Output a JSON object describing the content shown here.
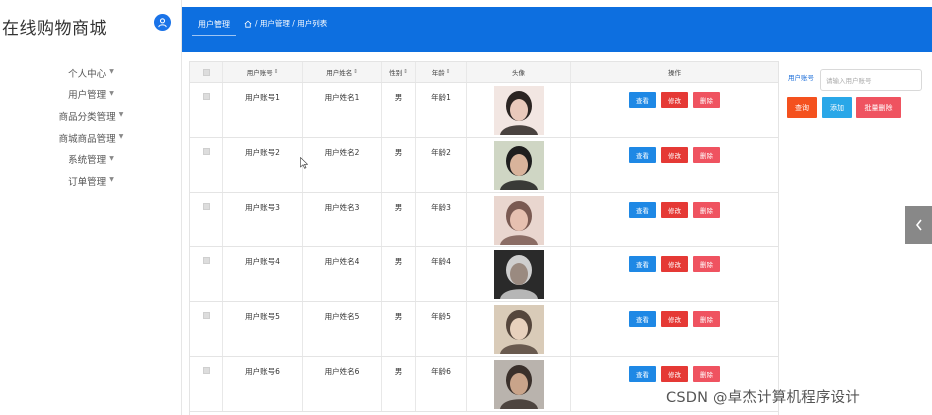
{
  "app": {
    "brand": "在线购物商城"
  },
  "sidebar": {
    "items": [
      {
        "label": "个人中心"
      },
      {
        "label": "用户管理"
      },
      {
        "label": "商品分类管理"
      },
      {
        "label": "商城商品管理"
      },
      {
        "label": "系统管理"
      },
      {
        "label": "订单管理"
      }
    ]
  },
  "header": {
    "tab": "用户管理",
    "breadcrumb": "/ 用户管理 / 用户列表"
  },
  "table": {
    "headers": {
      "account": "用户账号",
      "name": "用户姓名",
      "sex": "性别",
      "age": "年龄",
      "photo": "头像",
      "ops": "操作",
      "sort_mark": "⇕"
    },
    "rows": [
      {
        "account": "用户账号1",
        "name": "用户姓名1",
        "sex": "男",
        "age": "年龄1"
      },
      {
        "account": "用户账号2",
        "name": "用户姓名2",
        "sex": "男",
        "age": "年龄2"
      },
      {
        "account": "用户账号3",
        "name": "用户姓名3",
        "sex": "男",
        "age": "年龄3"
      },
      {
        "account": "用户账号4",
        "name": "用户姓名4",
        "sex": "男",
        "age": "年龄4"
      },
      {
        "account": "用户账号5",
        "name": "用户姓名5",
        "sex": "男",
        "age": "年龄5"
      },
      {
        "account": "用户账号6",
        "name": "用户姓名6",
        "sex": "男",
        "age": "年龄6"
      }
    ],
    "actions": {
      "view": "查看",
      "edit": "修改",
      "delete": "删除"
    }
  },
  "search": {
    "label": "用户账号",
    "placeholder": "请输入用户账号",
    "query": "查询",
    "add": "添加",
    "batch_delete": "批量删除"
  },
  "watermark": "CSDN @卓杰计算机程序设计",
  "colors": {
    "header": "#0d6fe0",
    "view": "#1e88e5",
    "edit": "#e53935",
    "delete": "#ef5360",
    "query": "#f4511e",
    "add": "#29a7e8"
  }
}
